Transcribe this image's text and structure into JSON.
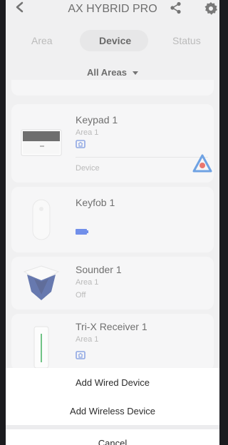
{
  "header": {
    "title": "AX HYBRID PRO"
  },
  "tabs": {
    "area": "Area",
    "device": "Device",
    "status": "Status"
  },
  "filter": {
    "label": "All Areas"
  },
  "devices": [
    {
      "name": "Keypad 1",
      "area": "Area 1",
      "type": "Device",
      "icon": "keypad"
    },
    {
      "name": "Keyfob 1",
      "icon": "keyfob"
    },
    {
      "name": "Sounder 1",
      "area": "Area 1",
      "state": "Off",
      "icon": "sounder"
    },
    {
      "name": "Tri-X Receiver 1",
      "area": "Area 1",
      "icon": "receiver"
    }
  ],
  "sheet": {
    "add_wired": "Add Wired Device",
    "add_wireless": "Add Wireless Device",
    "cancel": "Cancel"
  },
  "colors": {
    "accent_blue": "#2f5be0",
    "zone_icon_blue": "#5a7ed8",
    "logo_red": "#e0352a",
    "logo_blue": "#2b76d6"
  }
}
